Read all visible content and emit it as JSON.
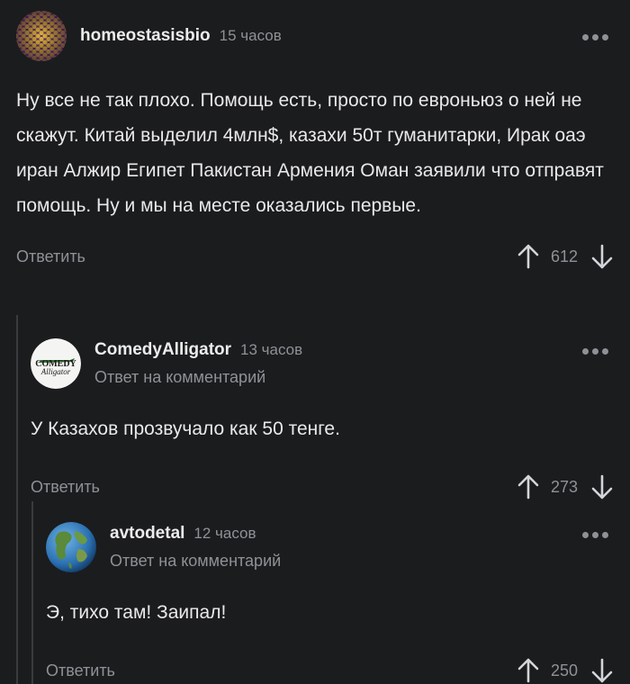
{
  "comments": [
    {
      "username": "homeostasisbio",
      "time": "15 часов",
      "text": "Ну все не так плохо. Помощь есть, просто по евроньюз о ней не скажут. Китай выделил 4млн$, казахи 50т гуманитарки, Ирак оаэ иран Алжир Египет Пакистан Армения Оман заявили что отправят помощь. Ну и мы на месте оказались первые.",
      "reply_label": "Ответить",
      "score": "612"
    },
    {
      "username": "ComedyAlligator",
      "time": "13 часов",
      "reply_to": "Ответ на комментарий",
      "avatar_text_top": "COMEDY",
      "avatar_text_bottom": "Alligator",
      "text": "У Казахов прозвучало как 50 тенге.",
      "reply_label": "Ответить",
      "score": "273"
    },
    {
      "username": "avtodetal",
      "time": "12 часов",
      "reply_to": "Ответ на комментарий",
      "text": "Э, тихо там! Заипал!",
      "reply_label": "Ответить",
      "score": "250"
    }
  ],
  "icons": {
    "more": "more-dots-icon",
    "upvote": "arrow-up-icon",
    "downvote": "arrow-down-icon"
  },
  "colors": {
    "background": "#1b1c1e",
    "text": "#e9e9e9",
    "muted": "#8f9196",
    "thread_line": "#3a3b3e"
  }
}
